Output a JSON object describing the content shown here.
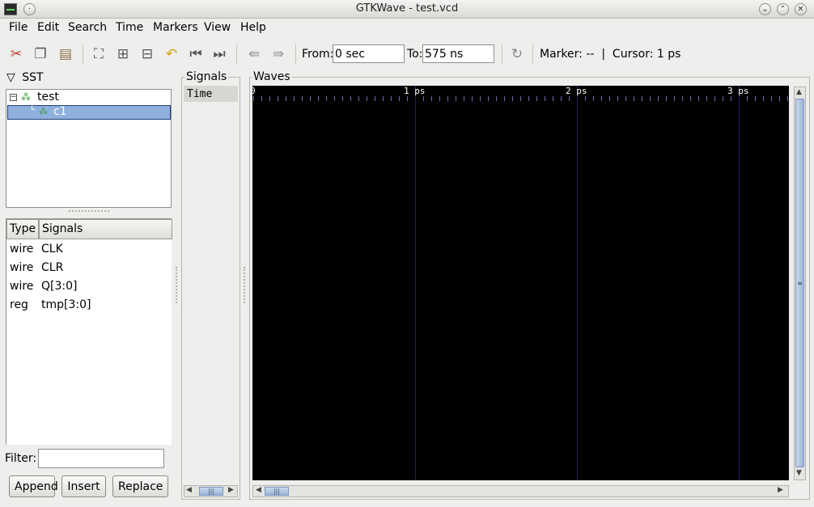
{
  "window": {
    "title": "GTKWave - test.vcd"
  },
  "menu": [
    "File",
    "Edit",
    "Search",
    "Time",
    "Markers",
    "View",
    "Help"
  ],
  "toolbar": {
    "icons": [
      "cut-icon",
      "copy-icon",
      "paste-icon",
      "zoom-fit-icon",
      "zoom-in-icon",
      "zoom-out-icon",
      "undo-icon",
      "go-start-icon",
      "go-end-icon",
      "prev-edge-icon",
      "next-edge-icon",
      "reload-icon"
    ],
    "from_label": "From:",
    "from_value": "0 sec",
    "to_label": "To:",
    "to_value": "575 ns",
    "marker_text": "Marker: --  |  Cursor: 1 ps"
  },
  "sst": {
    "title": "SST",
    "tree": [
      {
        "label": "test",
        "expanded": true
      },
      {
        "label": "c1",
        "selected": true
      }
    ],
    "columns": [
      "Type",
      "Signals"
    ],
    "signals": [
      {
        "type": "wire",
        "name": "CLK"
      },
      {
        "type": "wire",
        "name": "CLR"
      },
      {
        "type": "wire",
        "name": "Q[3:0]"
      },
      {
        "type": "reg",
        "name": "tmp[3:0]"
      }
    ],
    "filter_label": "Filter:",
    "filter_value": "",
    "buttons": [
      "Append",
      "Insert",
      "Replace"
    ]
  },
  "signals_pane": {
    "title": "Signals",
    "rows": [
      "Time"
    ]
  },
  "waves_pane": {
    "title": "Waves",
    "time_labels": [
      "0",
      "1 ps",
      "2 ps",
      "3 ps"
    ],
    "colors": {
      "background": "#000000",
      "grid": "#23235e",
      "tick": "#6e6ea8",
      "label": "#ffffff"
    }
  }
}
